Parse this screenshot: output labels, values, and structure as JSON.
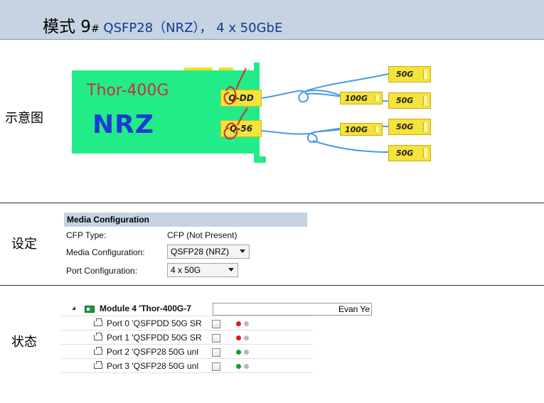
{
  "header": {
    "mode": "模式 9",
    "hash": "#",
    "rest": " QSFP28（NRZ），  4 x 50GbE"
  },
  "sections": {
    "diagram": "示意图",
    "settings": "设定",
    "status": "状态"
  },
  "diagram": {
    "card_name": "Thor-400G",
    "signaling": "NRZ",
    "ports": [
      {
        "label": "Q-DD"
      },
      {
        "label": "Q-56"
      }
    ],
    "modules_100g": [
      "100G",
      "100G"
    ],
    "modules_50g": [
      "50G",
      "50G",
      "50G",
      "50G"
    ],
    "colors": {
      "card": "#22ec88",
      "module": "#f5e23a",
      "cable": "#4a9be0",
      "mark": "#c8303a"
    }
  },
  "media_config": {
    "title": "Media Configuration",
    "cfp_type_label": "CFP Type:",
    "cfp_type_value": "CFP (Not Present)",
    "media_label": "Media Configuration:",
    "media_value": "QSFP28 (NRZ)",
    "port_label": "Port Configuration:",
    "port_value": "4 x 50G"
  },
  "status": {
    "module_name": "Module 4 'Thor-400G-7",
    "owner": "Evan Ye",
    "ports": [
      {
        "name": "Port 0 'QSFPDD 50G SR",
        "checked": false,
        "link_color": "#e01a1a"
      },
      {
        "name": "Port 1 'QSFPDD 50G SR",
        "checked": false,
        "link_color": "#e01a1a"
      },
      {
        "name": "Port 2 'QSFP28 50G unl",
        "checked": false,
        "link_color": "#1a9a2a"
      },
      {
        "name": "Port 3 'QSFP28 50G unl",
        "checked": false,
        "link_color": "#1a9a2a"
      }
    ]
  }
}
